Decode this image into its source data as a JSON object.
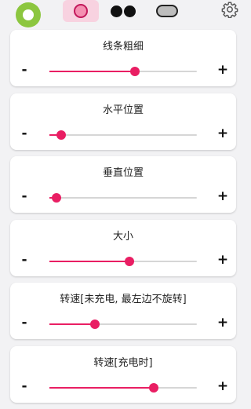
{
  "toolbar": {
    "shape_tabs": [
      {
        "name": "ring",
        "active": true
      },
      {
        "name": "glasses",
        "active": false
      },
      {
        "name": "pill",
        "active": false
      }
    ]
  },
  "colors": {
    "accent": "#e91e63",
    "logo_green": "#8cc63f",
    "active_tab_bg": "#f8d2e0"
  },
  "sliders": [
    {
      "label": "线条粗细",
      "value": 0.58,
      "minus": "-",
      "plus": "+"
    },
    {
      "label": "水平位置",
      "value": 0.08,
      "minus": "-",
      "plus": "+"
    },
    {
      "label": "垂直位置",
      "value": 0.05,
      "minus": "-",
      "plus": "+"
    },
    {
      "label": "大小",
      "value": 0.54,
      "minus": "-",
      "plus": "+"
    },
    {
      "label": "转速[未充电, 最左边不旋转]",
      "value": 0.31,
      "minus": "-",
      "plus": "+"
    },
    {
      "label": "转速[充电时]",
      "value": 0.71,
      "minus": "-",
      "plus": "+"
    }
  ]
}
